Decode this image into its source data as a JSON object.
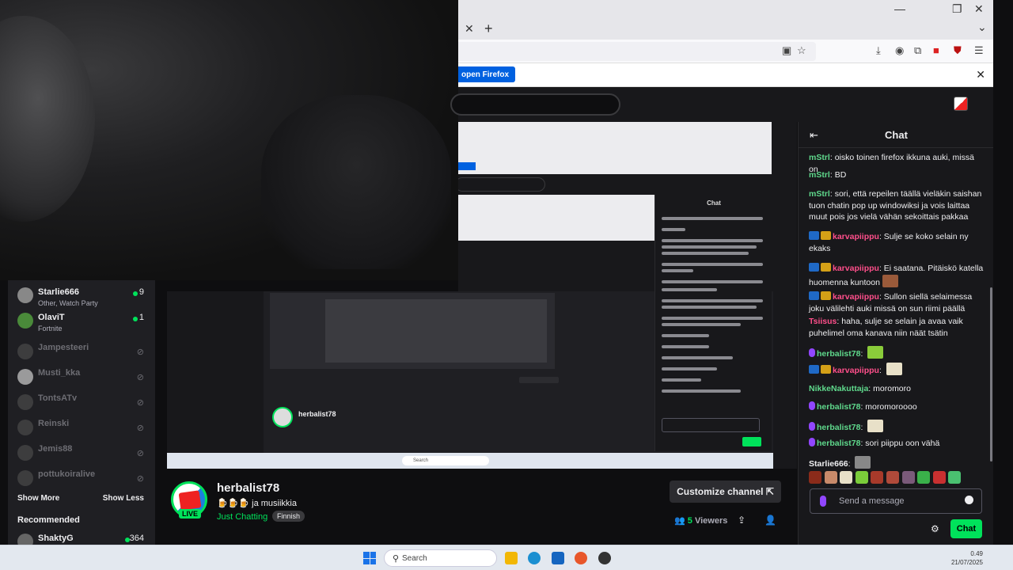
{
  "chrome": {
    "open_firefox_label": "open Firefox",
    "close_glyph": "✕",
    "new_tab_glyph": "+",
    "minimize_glyph": "—",
    "maximize_glyph": "❐",
    "window_close_glyph": "✕",
    "dropdown_glyph": "⌄"
  },
  "sidebar": {
    "channels": [
      {
        "name": "Starlie666",
        "sub": "Other, Watch Party",
        "count": "9",
        "online": true
      },
      {
        "name": "OlaviT",
        "sub": "Fortnite",
        "count": "1",
        "online": true
      },
      {
        "name": "Jampesteeri",
        "sub": "",
        "count": "",
        "online": false
      },
      {
        "name": "Musti_kka",
        "sub": "",
        "count": "",
        "online": false
      },
      {
        "name": "TontsATv",
        "sub": "",
        "count": "",
        "online": false
      },
      {
        "name": "Reinski",
        "sub": "",
        "count": "",
        "online": false
      },
      {
        "name": "Jemis88",
        "sub": "",
        "count": "",
        "online": false
      },
      {
        "name": "pottukoiralive",
        "sub": "",
        "count": "",
        "online": false
      }
    ],
    "show_more": "Show More",
    "show_less": "Show Less",
    "recommended_heading": "Recommended",
    "recommended": {
      "name": "ShaktyG",
      "count": "364"
    }
  },
  "channel": {
    "name": "herbalist78",
    "title": "🍺🍺🍺 ja musiikkia",
    "category": "Just Chatting",
    "language_tag": "Finnish",
    "live_label": "LIVE",
    "customize_label": "Customize channel ⇱",
    "viewers_count": "5",
    "viewers_label": "Viewers"
  },
  "chat": {
    "title": "Chat",
    "placeholder": "Send a message",
    "send_label": "Chat",
    "messages": [
      {
        "user": "mStrl",
        "color": "#5fd98c",
        "badges": [],
        "text": "oisko toinen firefox ikkuna auki, missä on"
      },
      {
        "user": "mStrl",
        "color": "#5fd98c",
        "badges": [],
        "text": "BD"
      },
      {
        "user": "mStrl",
        "color": "#5fd98c",
        "badges": [],
        "text": "sori, että repeilen täällä vieläkin saishan tuon chatin pop up windowiksi ja vois laittaa muut pois jos vielä vähän sekoittais pakkaa"
      },
      {
        "user": "karvapiippu",
        "color": "#ff4f8b",
        "badges": [
          "blue",
          "gold"
        ],
        "text": "Sulje se koko selain ny ekaks"
      },
      {
        "user": "karvapiippu",
        "color": "#ff4f8b",
        "badges": [
          "blue",
          "gold"
        ],
        "text": "Ei saatana. Pitäiskö katella huomenna kuntoon"
      },
      {
        "user": "karvapiippu",
        "color": "#ff4f8b",
        "badges": [
          "blue",
          "gold"
        ],
        "text": "Sullon siellä selaimessa joku välilehti auki missä on sun riimi päällä"
      },
      {
        "user": "Tsiisus",
        "color": "#ff4f8b",
        "badges": [],
        "text": "haha, sulje se selain ja avaa vaik puhelimel oma kanava niin näät tsätin"
      },
      {
        "user": "herbalist78",
        "color": "#5fd98c",
        "badges": [
          "mic"
        ],
        "text": ""
      },
      {
        "user": "karvapiippu",
        "color": "#ff4f8b",
        "badges": [
          "blue",
          "gold"
        ],
        "text": ""
      },
      {
        "user": "NikkeNakuttaja",
        "color": "#5fd98c",
        "badges": [],
        "text": "moromoro"
      },
      {
        "user": "herbalist78",
        "color": "#5fd98c",
        "badges": [
          "mic"
        ],
        "text": "moromoroooo"
      },
      {
        "user": "herbalist78",
        "color": "#5fd98c",
        "badges": [
          "mic"
        ],
        "text": ""
      },
      {
        "user": "herbalist78",
        "color": "#5fd98c",
        "badges": [
          "mic"
        ],
        "text": "sori piippu oon vähä"
      },
      {
        "user": "Starlie666",
        "color": "#efeff1",
        "badges": [],
        "text": ""
      }
    ]
  },
  "nested": {
    "chat_title": "Chat",
    "search_label": "Search"
  },
  "taskbar": {
    "search_label": "Search",
    "time": "0.49",
    "date": "21/07/2025"
  },
  "colors": {
    "accent": "#00e25b",
    "purple": "#9146ff",
    "background": "#0e0e10",
    "panel": "#18181b"
  }
}
